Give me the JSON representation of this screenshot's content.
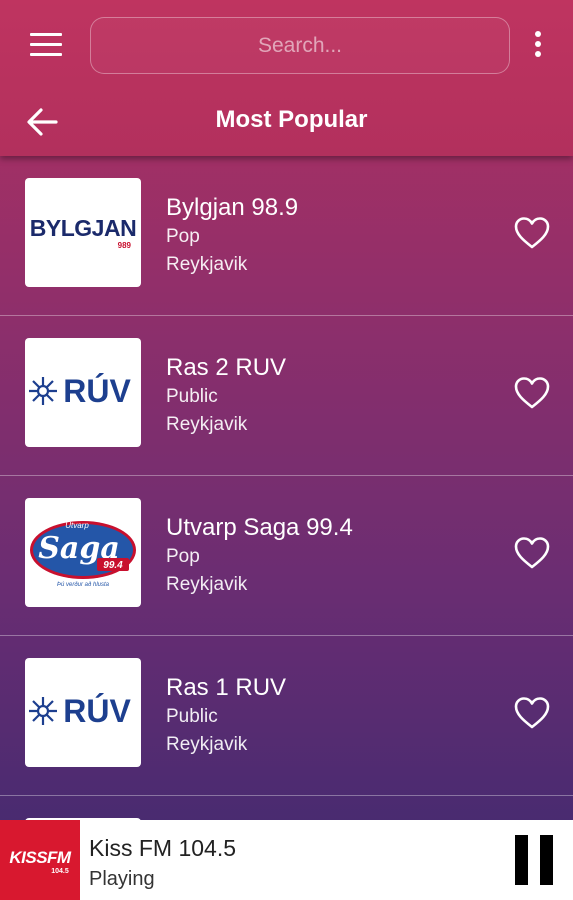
{
  "header": {
    "search_placeholder": "Search...",
    "title": "Most Popular",
    "icons": {
      "menu": "hamburger-menu-icon",
      "more": "more-vertical-icon",
      "back": "arrow-left-icon"
    }
  },
  "stations": [
    {
      "name": "Bylgjan 98.9",
      "genre": "Pop",
      "city": "Reykjavik",
      "logo": {
        "text": "BYLGJAN",
        "sub": "989"
      }
    },
    {
      "name": "Ras 2 RUV",
      "genre": "Public",
      "city": "Reykjavik",
      "logo": {
        "text": "RÚV"
      }
    },
    {
      "name": "Utvarp Saga 99.4",
      "genre": "Pop",
      "city": "Reykjavik",
      "logo": {
        "text": "Saga",
        "top": "Útvarp",
        "sub": "99.4",
        "tagline": "Þú verður að hlusta"
      }
    },
    {
      "name": "Ras 1 RUV",
      "genre": "Public",
      "city": "Reykjavik",
      "logo": {
        "text": "RÚV"
      }
    }
  ],
  "player": {
    "name": "Kiss FM 104.5",
    "status": "Playing",
    "logo": {
      "text": "KISSFM",
      "sub": "104.5"
    }
  },
  "colors": {
    "header": "#bf3460",
    "gradient_top": "#b3305f",
    "gradient_bottom": "#3e2a70",
    "ruv_blue": "#1d3f8f",
    "kiss_red": "#d8182f"
  }
}
